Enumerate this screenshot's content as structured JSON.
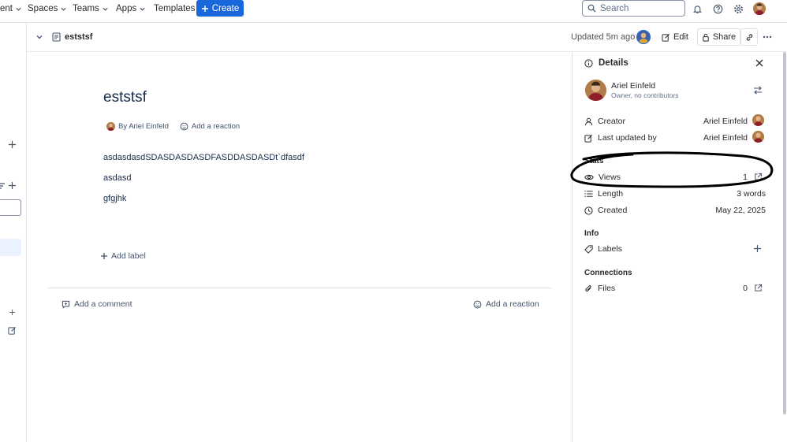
{
  "topnav": {
    "items": [
      {
        "label": "ent"
      },
      {
        "label": "Spaces"
      },
      {
        "label": "Teams"
      },
      {
        "label": "Apps"
      },
      {
        "label": "Templates"
      }
    ],
    "create_label": "Create",
    "search_placeholder": "Search"
  },
  "header": {
    "title": "eststsf",
    "updated": "Updated 5m ago",
    "edit_label": "Edit",
    "share_label": "Share"
  },
  "page": {
    "title": "eststsf",
    "byline": "By Ariel Einfeld",
    "add_reaction": "Add a reaction",
    "paragraphs": [
      "asdasdasdSDASDASDASDFASDDASDASDt`dfasdf",
      "asdasd",
      "gfgjhk"
    ],
    "add_label": "Add label",
    "add_comment": "Add a comment",
    "add_reaction_bottom": "Add a reaction"
  },
  "details": {
    "title": "Details",
    "owner_name": "Ariel Einfeld",
    "owner_subtitle": "Owner, no contributors",
    "creator_label": "Creator",
    "creator_value": "Ariel Einfeld",
    "updated_by_label": "Last updated by",
    "updated_by_value": "Ariel Einfeld",
    "stats_heading": "Stats",
    "views_label": "Views",
    "views_value": "1",
    "length_label": "Length",
    "length_value": "3 words",
    "created_label": "Created",
    "created_value": "May 22, 2025",
    "info_heading": "Info",
    "labels_label": "Labels",
    "connections_heading": "Connections",
    "files_label": "Files",
    "files_value": "0"
  },
  "colors": {
    "primary": "#1868db",
    "text": "#292a2e",
    "border": "#e1e3e6",
    "selected_bg": "#e9f2fe",
    "annotation": "#000000"
  }
}
